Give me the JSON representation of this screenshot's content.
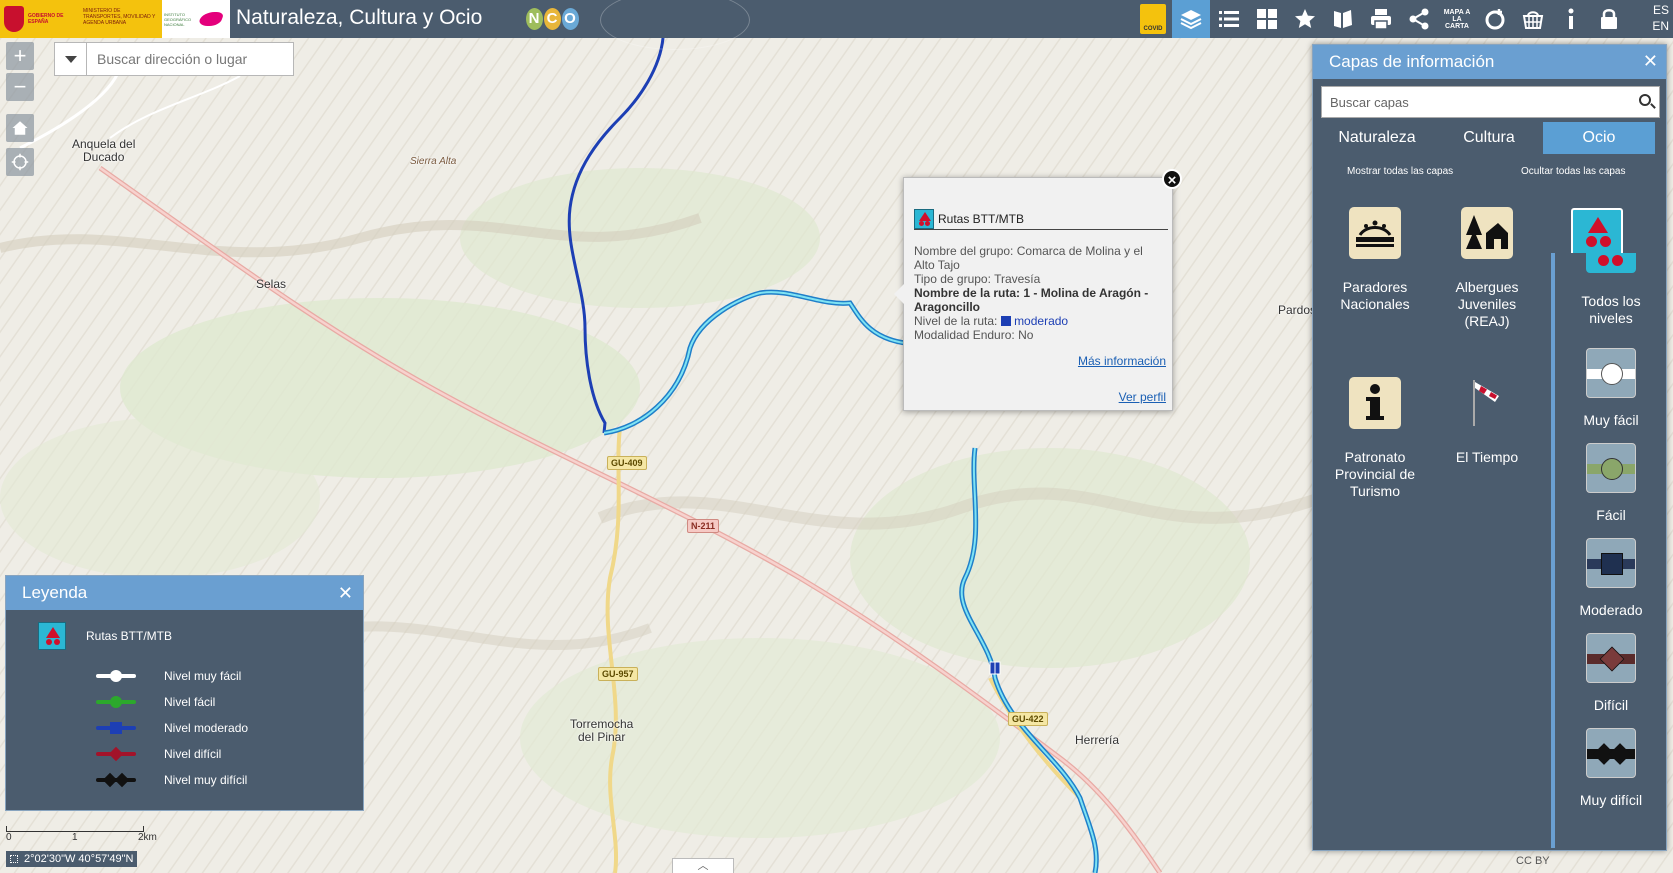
{
  "header": {
    "title": "Naturaleza, Cultura y Ocio",
    "logo_gobierno": "GOBIERNO DE ESPAÑA",
    "logo_ministerio": "MINISTERIO DE TRANSPORTES, MOVILIDAD Y AGENDA URBANA",
    "logo_ign": "INSTITUTO GEOGRÁFICO NACIONAL",
    "nco": [
      "N",
      "C",
      "O"
    ],
    "covid_label": "COVID",
    "mapa_label": "MAPA A LA CARTA",
    "language": "ES\nEN",
    "tools": [
      "covid-icon",
      "layers-icon",
      "list-icon",
      "grid-icon",
      "star-icon",
      "bookmark-icon",
      "print-icon",
      "share-icon",
      "mapa-a-la-carta-icon",
      "add-data-icon",
      "basket-icon",
      "info-icon",
      "lock-icon"
    ]
  },
  "search": {
    "placeholder": "Buscar dirección o lugar"
  },
  "map": {
    "places": [
      {
        "name": "Anquela del\nDucado"
      },
      {
        "name": "Sierra Alta"
      },
      {
        "name": "Selas"
      },
      {
        "name": "Torremocha\ndel Pinar"
      },
      {
        "name": "Herrería"
      },
      {
        "name": "Pardos"
      }
    ],
    "roads": [
      "GU-409",
      "N-211",
      "GU-957",
      "GU-422"
    ]
  },
  "popup": {
    "layer_title": "Rutas BTT/MTB",
    "grupo_label": "Nombre del grupo:",
    "grupo_value": "Comarca de Molina y el Alto Tajo",
    "tipo_label": "Tipo de grupo:",
    "tipo_value": "Travesía",
    "ruta_label": "Nombre de la ruta:",
    "ruta_value": "1 - Molina de Aragón - Aragoncillo",
    "nivel_label": "Nivel de la ruta:",
    "nivel_value": "moderado",
    "enduro_label": "Modalidad Enduro:",
    "enduro_value": "No",
    "more_info": "Más información",
    "profile": "Ver perfil"
  },
  "legend": {
    "title": "Leyenda",
    "layer_name": "Rutas BTT/MTB",
    "items": [
      {
        "label": "Nivel muy fácil",
        "color": "#ffffff"
      },
      {
        "label": "Nivel fácil",
        "color": "#2ca82c"
      },
      {
        "label": "Nivel moderado",
        "color": "#1d3fb4"
      },
      {
        "label": "Nivel difícil",
        "color": "#a3132a"
      },
      {
        "label": "Nivel muy difícil",
        "color": "#111111"
      }
    ]
  },
  "layers_panel": {
    "title": "Capas de información",
    "search_placeholder": "Buscar capas",
    "tabs": [
      "Naturaleza",
      "Cultura",
      "Ocio"
    ],
    "active_tab": "Ocio",
    "show_all": "Mostrar todas las capas",
    "hide_all": "Ocultar todas las capas",
    "items": [
      {
        "label": "Paradores\nNacionales",
        "icon": "parador-icon"
      },
      {
        "label": "Albergues\nJuveniles\n(REAJ)",
        "icon": "albergue-icon"
      },
      {
        "label": "Patronato\nProvincial de\nTurismo",
        "icon": "info-icon"
      },
      {
        "label": "El Tiempo",
        "icon": "windsock-icon"
      }
    ],
    "sublevels": [
      {
        "label": "Todos los\nniveles"
      },
      {
        "label": "Muy fácil"
      },
      {
        "label": "Fácil"
      },
      {
        "label": "Moderado"
      },
      {
        "label": "Difícil"
      },
      {
        "label": "Muy difícil"
      }
    ]
  },
  "footer": {
    "scale_labels": [
      "0",
      "1",
      "2km"
    ],
    "coordinates": "2°02'30\"W 40°57'49\"N",
    "attribution": "CC BY"
  }
}
